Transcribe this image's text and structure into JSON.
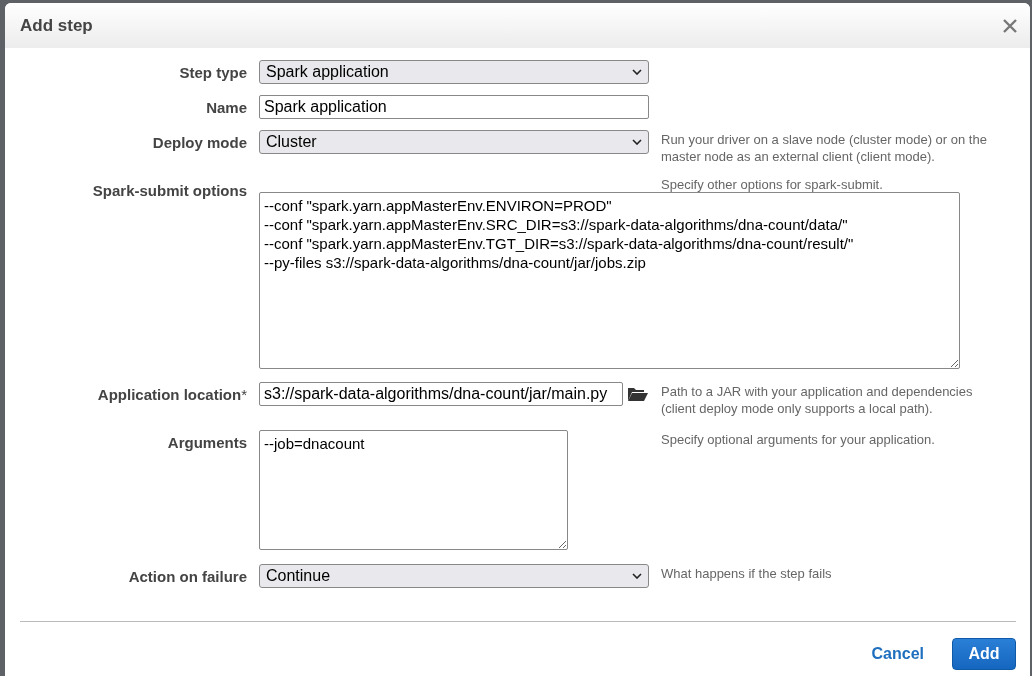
{
  "dialog": {
    "title": "Add step"
  },
  "fields": [
    {
      "kind": "select",
      "label": "Step type",
      "value": "Spark application"
    },
    {
      "kind": "input",
      "label": "Name",
      "value": "Spark application"
    },
    {
      "kind": "select",
      "label": "Deploy mode",
      "value": "Cluster",
      "hint": "Run your driver on a slave node (cluster mode) or on the master node as an external client (client mode)."
    },
    {
      "kind": "wide-textarea",
      "label": "Spark-submit options",
      "value": "--conf \"spark.yarn.appMasterEnv.ENVIRON=PROD\"\n--conf \"spark.yarn.appMasterEnv.SRC_DIR=s3://spark-data-algorithms/dna-count/data/\"\n--conf \"spark.yarn.appMasterEnv.TGT_DIR=s3://spark-data-algorithms/dna-count/result/\"\n--py-files s3://spark-data-algorithms/dna-count/jar/jobs.zip",
      "hint": "Specify other options for spark-submit."
    },
    {
      "kind": "file",
      "label": "Application location",
      "required_mark": "*",
      "value": "s3://spark-data-algorithms/dna-count/jar/main.py",
      "hint": "Path to a JAR with your application and dependencies (client deploy mode only supports a local path)."
    },
    {
      "kind": "textarea",
      "label": "Arguments",
      "value": "--job=dnacount",
      "hint": "Specify optional arguments for your application."
    },
    {
      "kind": "select",
      "label": "Action on failure",
      "value": "Continue",
      "hint": "What happens if the step fails"
    }
  ],
  "buttons": [
    {
      "kind": "link",
      "label": "Cancel"
    },
    {
      "kind": "primary",
      "label": "Add"
    }
  ]
}
